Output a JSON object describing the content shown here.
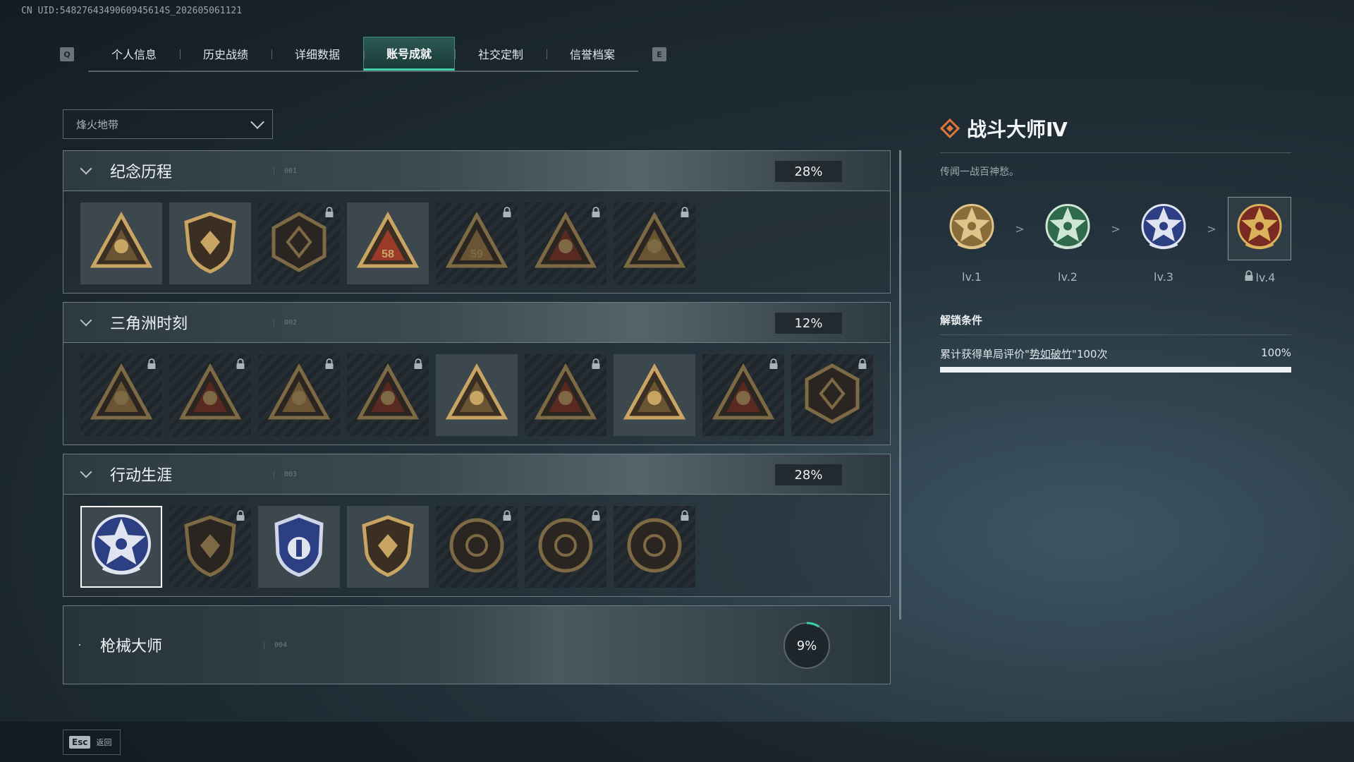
{
  "uid": "CN UID:5482764349060945614S_202605061121",
  "tabs": {
    "prev_key": "Q",
    "next_key": "E",
    "items": [
      "个人信息",
      "历史战绩",
      "详细数据",
      "账号成就",
      "社交定制",
      "信誉档案"
    ],
    "active": "账号成就"
  },
  "dropdown": {
    "value": "烽火地带"
  },
  "sections": [
    {
      "title": "纪念历程",
      "num": "001",
      "percent": "28%",
      "expanded": true,
      "badges": [
        {
          "icon": "triangle-mountain-badge-icon",
          "locked": false
        },
        {
          "icon": "helicopter-badge-icon",
          "locked": false
        },
        {
          "icon": "hex-shield-badge-icon",
          "locked": true
        },
        {
          "icon": "tower-58-badge-icon",
          "locked": false,
          "text": "58"
        },
        {
          "icon": "tower-59-badge-icon",
          "locked": true,
          "text": "59"
        },
        {
          "icon": "hooded-figure-badge-icon",
          "locked": true
        },
        {
          "icon": "crossed-soldier-badge-icon",
          "locked": true
        }
      ]
    },
    {
      "title": "三角洲时刻",
      "num": "002",
      "percent": "12%",
      "expanded": true,
      "badges": [
        {
          "icon": "bottle-badge-icon",
          "locked": true
        },
        {
          "icon": "helmet-badge-icon",
          "locked": true
        },
        {
          "icon": "diver-badge-icon",
          "locked": true
        },
        {
          "icon": "gear-crest-badge-icon",
          "locked": true
        },
        {
          "icon": "squad-badge-icon",
          "locked": false
        },
        {
          "icon": "wolves-badge-icon",
          "locked": true
        },
        {
          "icon": "rocket-badge-icon",
          "locked": false
        },
        {
          "icon": "dolphin-badge-icon",
          "locked": true
        },
        {
          "icon": "crate-diamond-badge-icon",
          "locked": true
        }
      ]
    },
    {
      "title": "行动生涯",
      "num": "003",
      "percent": "28%",
      "expanded": true,
      "badges": [
        {
          "icon": "star-skull-medal-icon",
          "locked": false,
          "selected": true
        },
        {
          "icon": "wing-shield-medal-icon",
          "locked": true
        },
        {
          "icon": "blue-crest-medal-icon",
          "locked": false
        },
        {
          "icon": "gem-shield-medal-icon",
          "locked": false
        },
        {
          "icon": "ring-medal-icon",
          "locked": true
        },
        {
          "icon": "skull-disc-medal-icon",
          "locked": true
        },
        {
          "icon": "eye-disc-medal-icon",
          "locked": true
        }
      ]
    },
    {
      "title": "枪械大师",
      "num": "004",
      "percent": "9%",
      "progress": 0.09,
      "expanded": false
    }
  ],
  "detail": {
    "title": "战斗大师Ⅳ",
    "description": "传闻一战百神愁。",
    "levels": [
      {
        "label": "lv.1",
        "icon": "gold-star-medal-icon",
        "locked": false
      },
      {
        "label": "lv.2",
        "icon": "green-star-medal-icon",
        "locked": false
      },
      {
        "label": "lv.3",
        "icon": "blue-star-medal-icon",
        "locked": false
      },
      {
        "label": "lv.4",
        "icon": "red-star-medal-icon",
        "locked": true
      }
    ],
    "separator": ">",
    "unlock_title": "解锁条件",
    "condition_prefix": "累计获得单局评价\"",
    "condition_link": "势如破竹",
    "condition_suffix": "\"100次",
    "condition_percent": "100%",
    "condition_progress": 1.0
  },
  "footer": {
    "key": "Esc",
    "label": "返回"
  },
  "colors": {
    "accent": "#3fd0a6",
    "gold": "#c9a563",
    "red": "#9c2b22"
  }
}
